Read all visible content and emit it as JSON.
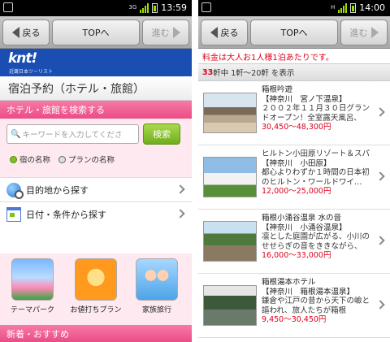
{
  "left_screen": {
    "status": {
      "network": "3G",
      "clock": "13:59"
    },
    "toolbar": {
      "back": "戻る",
      "top": "TOPへ",
      "forward": "進む"
    },
    "brand": {
      "logo": "knt!",
      "sub": "近畿日本ツーリスト"
    },
    "page_title": "宿泊予約（ホテル・旅館）",
    "search": {
      "header": "ホテル・旅館を検索する",
      "placeholder": "キーワードを入力してくださ",
      "button": "検索",
      "radio_hotel": "宿の名称",
      "radio_plan": "プランの名称"
    },
    "nav": {
      "destination": "目的地から探す",
      "date": "日付・条件から探す"
    },
    "categories": [
      {
        "label": "テーマパーク",
        "icon": "theme-park-icon"
      },
      {
        "label": "お値打ちプラン",
        "icon": "deal-plan-icon"
      },
      {
        "label": "家族旅行",
        "icon": "family-travel-icon"
      }
    ],
    "recommend": "新着・おすすめ"
  },
  "right_screen": {
    "status": {
      "network": "H",
      "clock": "14:00"
    },
    "toolbar": {
      "back": "戻る",
      "top": "TOPへ",
      "forward": "進む"
    },
    "price_note": "料金は大人お1人様1泊あたりです。",
    "count": {
      "total": "33",
      "rest": "軒中 1軒～20軒 を表示"
    },
    "hotels": [
      {
        "name": "箱根吟遊",
        "area": "【神奈川　宮ノ下温泉】",
        "desc": "２００２年１１月３０日グランドオープン！全室露天風呂、",
        "price": "30,450～48,300円"
      },
      {
        "name": "ヒルトン小田原リゾート＆スパ",
        "area": "【神奈川　小田原】",
        "desc": "都心よりわずか１時間の日本初のヒルトン・ワールドワイ…",
        "price": "12,000～25,000円"
      },
      {
        "name": "箱根小涌谷温泉 水の音",
        "area": "【神奈川　小涌谷温泉】",
        "desc": "凛とした庭園が広がる、小川のせせらぎの音をききながら、",
        "price": "16,000～33,000円"
      },
      {
        "name": "箱根湯本ホテル",
        "area": "【神奈川　箱根湯本温泉】",
        "desc": "鎌倉や江戸の昔から天下の嶮と謳われ、旅人たちが箱根",
        "price": "9,450～30,450円"
      }
    ]
  },
  "colors": {
    "brand_blue": "#1a4eb3",
    "pink": "#ea4d86",
    "price_red": "#e0001b",
    "search_green": "#6fae1c"
  }
}
